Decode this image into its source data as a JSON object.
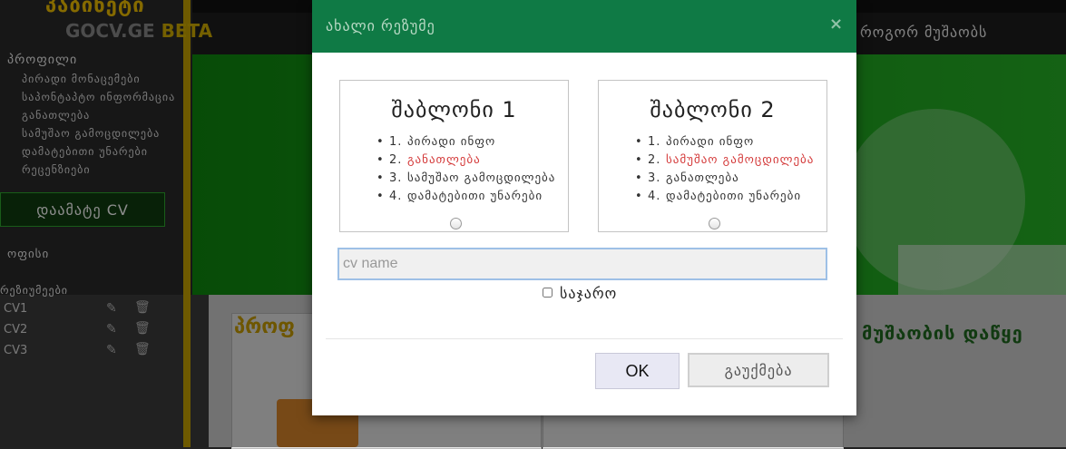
{
  "background": {
    "brand_title": "პაბინეტი",
    "brand_logo": "GOCV.GE",
    "brand_beta": "BETA",
    "nav_right": "როგორ მუშაობს",
    "content_title_left": "პროფ",
    "content_title_right": "მუშაობის დაწყე"
  },
  "sidebar": {
    "profile_heading": "პროფილი",
    "items": [
      {
        "label": "პირადი მონაცემები"
      },
      {
        "label": "საპონტაპტო ინფორმაცია"
      },
      {
        "label": "განათლება"
      },
      {
        "label": "სამუშაო გამოცდილება"
      },
      {
        "label": "დამატებითი უნარები"
      },
      {
        "label": "რეცენზიები"
      }
    ],
    "add_cv_label": "დაამატე CV",
    "office_label": "ოფისი",
    "resumes_label": "რეზიუმეები",
    "cvs": [
      {
        "name": "CV1"
      },
      {
        "name": "CV2"
      },
      {
        "name": "CV3"
      }
    ]
  },
  "modal": {
    "title": "ახალი რეზუმე",
    "close_symbol": "×",
    "templates": [
      {
        "title": "შაბლონი 1",
        "items": [
          {
            "num": "1.",
            "label": "პირადი ინფო",
            "highlight": false
          },
          {
            "num": "2.",
            "label": "განათლება",
            "highlight": true
          },
          {
            "num": "3.",
            "label": "სამუშაო გამოცდილება",
            "highlight": false
          },
          {
            "num": "4.",
            "label": "დამატებითი უნარები",
            "highlight": false
          }
        ]
      },
      {
        "title": "შაბლონი 2",
        "items": [
          {
            "num": "1.",
            "label": "პირადი ინფო",
            "highlight": false
          },
          {
            "num": "2.",
            "label": "სამუშაო გამოცდილება",
            "highlight": true
          },
          {
            "num": "3.",
            "label": "განათლება",
            "highlight": false
          },
          {
            "num": "4.",
            "label": "დამატებითი უნარები",
            "highlight": false
          }
        ]
      }
    ],
    "cv_name_placeholder": "cv name",
    "cv_name_value": "",
    "public_label": "საჯარო",
    "ok_label": "OK",
    "cancel_label": "გაუქმება"
  },
  "colors": {
    "modal_header": "#0f7a45",
    "highlight_text": "#d43a3a",
    "sidebar_accent": "#c9a400",
    "add_cv_border": "#2fa82f"
  }
}
